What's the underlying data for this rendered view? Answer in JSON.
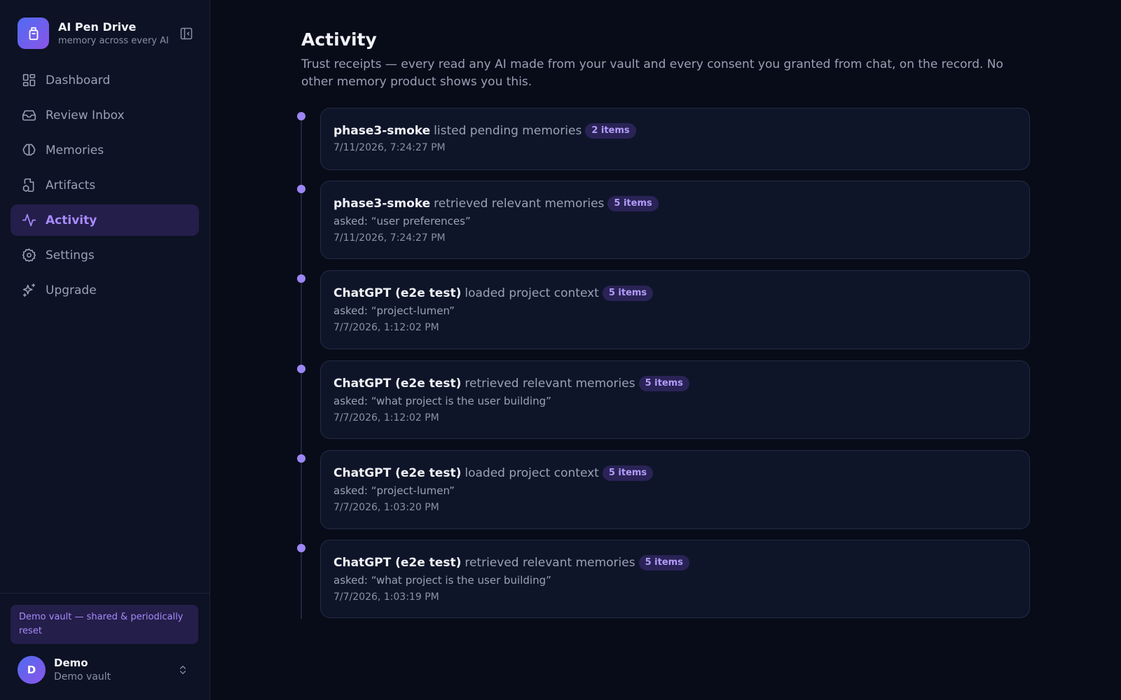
{
  "brand": {
    "name": "AI Pen Drive",
    "tagline": "memory across every AI"
  },
  "nav": {
    "items": [
      {
        "label": "Dashboard",
        "icon": "dashboard-icon"
      },
      {
        "label": "Review Inbox",
        "icon": "inbox-icon"
      },
      {
        "label": "Memories",
        "icon": "brain-icon"
      },
      {
        "label": "Artifacts",
        "icon": "artifacts-icon"
      },
      {
        "label": "Activity",
        "icon": "activity-icon",
        "active": true
      },
      {
        "label": "Settings",
        "icon": "gear-icon"
      },
      {
        "label": "Upgrade",
        "icon": "sparkles-icon"
      }
    ]
  },
  "demo_banner": "Demo vault — shared & periodically reset",
  "user": {
    "initial": "D",
    "name": "Demo",
    "vault": "Demo vault"
  },
  "page": {
    "title": "Activity",
    "description": "Trust receipts — every read any AI made from your vault and every consent you granted from chat, on the record. No other memory product shows you this."
  },
  "events": [
    {
      "actor": "phase3-smoke",
      "action": "listed pending memories",
      "badge": "2 items",
      "query": "",
      "time": "7/11/2026, 7:24:27 PM"
    },
    {
      "actor": "phase3-smoke",
      "action": "retrieved relevant memories",
      "badge": "5 items",
      "query": "asked: “user preferences”",
      "time": "7/11/2026, 7:24:27 PM"
    },
    {
      "actor": "ChatGPT (e2e test)",
      "action": "loaded project context",
      "badge": "5 items",
      "query": "asked: “project-lumen”",
      "time": "7/7/2026, 1:12:02 PM"
    },
    {
      "actor": "ChatGPT (e2e test)",
      "action": "retrieved relevant memories",
      "badge": "5 items",
      "query": "asked: “what project is the user building”",
      "time": "7/7/2026, 1:12:02 PM"
    },
    {
      "actor": "ChatGPT (e2e test)",
      "action": "loaded project context",
      "badge": "5 items",
      "query": "asked: “project-lumen”",
      "time": "7/7/2026, 1:03:20 PM"
    },
    {
      "actor": "ChatGPT (e2e test)",
      "action": "retrieved relevant memories",
      "badge": "5 items",
      "query": "asked: “what project is the user building”",
      "time": "7/7/2026, 1:03:19 PM"
    }
  ],
  "colors": {
    "accent": "#a78bfa",
    "background": "#080c18",
    "sidebar": "#0d1224",
    "card": "#0f1529"
  }
}
